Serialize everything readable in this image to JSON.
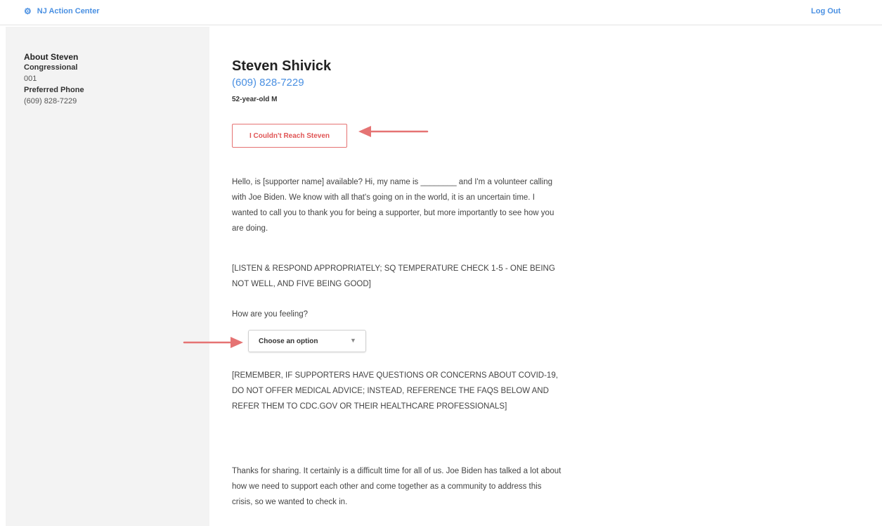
{
  "header": {
    "brand_icon": "gear-icon",
    "brand_label": "NJ Action Center",
    "logout_label": "Log Out",
    "link_color": "#4a90e2"
  },
  "sidebar": {
    "title": "About Steven",
    "fields": [
      {
        "label": "Congressional",
        "value": "001"
      },
      {
        "label": "Preferred Phone",
        "value": "(609) 828-7229"
      }
    ]
  },
  "contact": {
    "name": "Steven Shivick",
    "phone": "(609) 828-7229",
    "age_gender": "52-year-old M"
  },
  "actions": {
    "couldnt_reach_label": "I Couldn't Reach Steven",
    "accent_color": "#e57373"
  },
  "script": {
    "intro": "Hello, is [supporter name] available? Hi, my name is ________ and I'm a volunteer calling with Joe Biden. We know with all that's going on in the world, it is an uncertain time. I wanted to call you to thank you for being a supporter, but more importantly to see how you are doing.",
    "instruction_1": "[LISTEN & RESPOND APPROPRIATELY; SQ TEMPERATURE CHECK 1-5 - ONE BEING NOT WELL, AND FIVE BEING GOOD]",
    "question": "How are you feeling?",
    "instruction_2": "[REMEMBER, IF SUPPORTERS HAVE QUESTIONS OR CONCERNS ABOUT COVID-19, DO NOT OFFER MEDICAL ADVICE; INSTEAD, REFERENCE THE FAQS BELOW AND REFER THEM TO CDC.GOV OR THEIR HEALTHCARE PROFESSIONALS]",
    "closing": "Thanks for sharing. It certainly is a difficult time for all of us. Joe Biden has talked a lot about how we need to support each other and come together as a community to address this crisis, so we wanted to check in."
  },
  "feeling_select": {
    "value": "Choose an option",
    "caret_icon": "chevron-down-icon"
  },
  "annotations": {
    "arrow_color": "#e57373"
  }
}
